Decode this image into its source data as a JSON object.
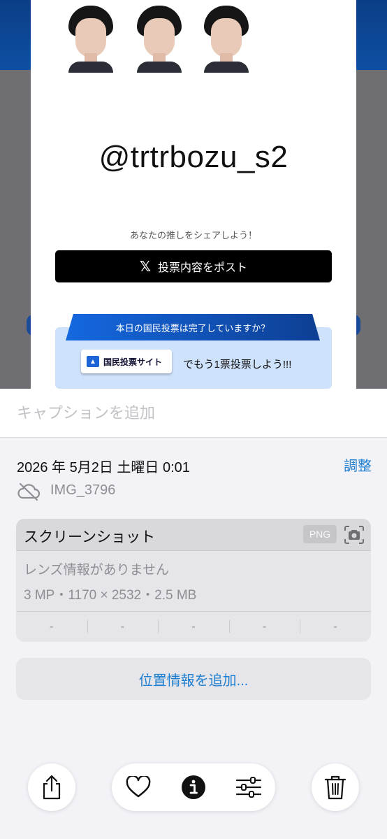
{
  "preview": {
    "handle": "@trtrbozu_s2",
    "share_caption": "あなたの推しをシェアしよう！",
    "post_label": "投票内容をポスト",
    "post_icon": "x-logo-icon",
    "vote_banner": "本日の国民投票は完了していますか？",
    "vote_site_label": "国民投票サイト",
    "vote_text": "でもう1票投票しよう!!!",
    "colors": {
      "brand_blue": "#0d4fa3",
      "banner_blue": "#1568e0",
      "vote_bg": "#cfe2fb"
    }
  },
  "sheet": {
    "caption_placeholder": "キャプションを追加",
    "datetime": "2026 年 5月2日 土曜日 0:01",
    "adjust_label": "調整",
    "filename": "IMG_3796",
    "cloud_icon": "cloud-off-icon",
    "meta": {
      "title": "スクリーンショット",
      "format_badge": "PNG",
      "lens": "レンズ情報がありません",
      "specs": "3 MP・1170 × 2532・2.5 MB",
      "exif": [
        "-",
        "-",
        "-",
        "-",
        "-"
      ]
    },
    "location_label": "位置情報を追加..."
  },
  "toolbar": {
    "items": [
      "share-icon",
      "heart-icon",
      "info-icon",
      "adjust-icon",
      "trash-icon"
    ],
    "accent": "#1f7fd0"
  }
}
